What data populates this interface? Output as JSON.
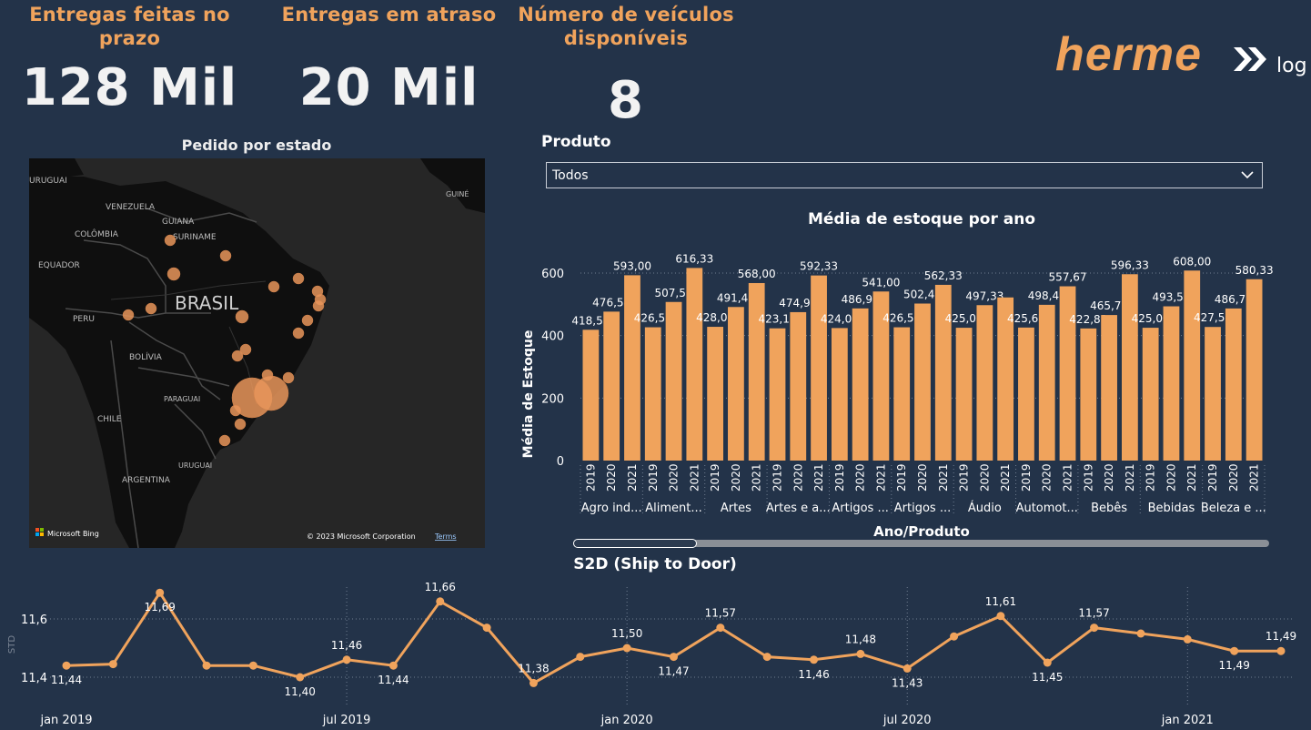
{
  "kpis": [
    {
      "title": "Entregas feitas no prazo",
      "value": "128 Mil"
    },
    {
      "title": "Entregas em atraso",
      "value": "20 Mil"
    },
    {
      "title_line1": "Número de veículos",
      "title_line2": "disponíveis",
      "value": "8"
    }
  ],
  "logo": {
    "word": "herme",
    "sub": "log",
    "icon": "double-chevron-x-icon"
  },
  "map": {
    "title": "Pedido por estado",
    "labels": [
      "GUIANA",
      "VENEZUELA",
      "COLÔMBIA",
      "SURINAME",
      "EQUADOR",
      "PERU",
      "BRASIL",
      "BOLÍVIA",
      "PARAGUAI",
      "CHILE",
      "URUGUAI",
      "ARGENTINA",
      "GUINÉ",
      "URUGUAI"
    ],
    "country_labels": [
      "URUGUAI",
      "VENEZUELA",
      "GUIANA",
      "COLÔMBIA",
      "SURINAME",
      "EQUADOR",
      "BRASIL",
      "PERU",
      "BOLÍVIA",
      "PARAGUAI",
      "CHILE",
      "ARGENTINA",
      "GUINÉ"
    ],
    "attribution": "Microsoft Bing",
    "copyright": "© 2023 Microsoft Corporation",
    "terms": "Terms",
    "bubble_color": "#e8955a"
  },
  "filter": {
    "label": "Produto",
    "value": "Todos"
  },
  "bar_chart": {
    "title": "Média de estoque por ano",
    "ylabel": "Média de Estoque",
    "xlabel": "Ano/Produto",
    "color": "#f0a35c"
  },
  "line_chart": {
    "title": "S2D (Ship to Door)",
    "ylabel": "STD",
    "color": "#f0a35c"
  },
  "chart_data": [
    {
      "type": "bar",
      "title": "Média de estoque por ano",
      "ylabel": "Média de Estoque",
      "xlabel": "Ano/Produto",
      "ylim": [
        0,
        650
      ],
      "yticks": [
        0,
        200,
        400,
        600
      ],
      "grid": true,
      "years": [
        "2019",
        "2020",
        "2021"
      ],
      "groups": [
        "Agro ind...",
        "Aliment...",
        "Artes",
        "Artes e a...",
        "Artigos ...",
        "Artigos ...",
        "Áudio",
        "Automot...",
        "Bebês",
        "Bebidas",
        "Beleza e ..."
      ],
      "values": [
        418.5,
        476.58,
        593.0,
        426.58,
        507.5,
        616.33,
        428.0,
        491.42,
        568.0,
        423.17,
        474.92,
        592.33,
        424.08,
        486.92,
        541.0,
        426.5,
        502.42,
        562.33,
        425.0,
        497.33,
        522.0,
        425.67,
        498.42,
        557.67,
        422.83,
        465.75,
        596.33,
        425.0,
        493.58,
        608.0,
        427.5,
        486.75,
        580.33
      ],
      "labels": [
        "418,50",
        "476,58",
        "593,00",
        "426,58",
        "507,50",
        "616,33",
        "428,00",
        "491,42",
        "568,00",
        "423,17",
        "474,92",
        "592,33",
        "424,08",
        "486,92",
        "541,00",
        "426,50",
        "502,42",
        "562,33",
        "425,00",
        "497,33",
        "",
        "425,67",
        "498,42",
        "557,67",
        "422,83",
        "465,75",
        "596,33",
        "425,00",
        "493,58",
        "608,00",
        "427,50",
        "486,75",
        "580,33"
      ]
    },
    {
      "type": "line",
      "title": "S2D (Ship to Door)",
      "ylabel": "STD",
      "ylim": [
        11.37,
        11.72
      ],
      "yticks": [
        11.4,
        11.6
      ],
      "ytick_labels": [
        "11,4",
        "11,6"
      ],
      "x": [
        "2019-01",
        "2019-02",
        "2019-03",
        "2019-04",
        "2019-05",
        "2019-06",
        "2019-07",
        "2019-08",
        "2019-09",
        "2019-10",
        "2019-11",
        "2019-12",
        "2020-01",
        "2020-02",
        "2020-03",
        "2020-04",
        "2020-05",
        "2020-06",
        "2020-07",
        "2020-08",
        "2020-09",
        "2020-10",
        "2020-11",
        "2020-12",
        "2021-01",
        "2021-02",
        "2021-03",
        "2021-04",
        "2021-05",
        "2021-06",
        "2021-07"
      ],
      "x_ticks": [
        "jan 2019",
        "jul 2019",
        "jan 2020",
        "jul 2020",
        "jan 2021"
      ],
      "values": [
        11.44,
        11.445,
        11.69,
        11.44,
        11.44,
        11.4,
        11.46,
        11.44,
        11.66,
        11.57,
        11.38,
        11.47,
        11.5,
        11.47,
        11.57,
        11.47,
        11.46,
        11.48,
        11.43,
        11.54,
        11.61,
        11.45,
        11.57,
        11.55,
        11.53,
        11.49,
        11.49
      ],
      "point_labels": [
        "11,44",
        "",
        "11,69",
        "",
        "",
        "11,40",
        "11,46",
        "11,44",
        "11,66",
        "",
        "11,38",
        "",
        "11,50",
        "11,47",
        "11,57",
        "",
        "11,46",
        "11,48",
        "11,43",
        "",
        "11,61",
        "11,45",
        "11,57",
        "",
        "",
        "11,49",
        "11,49"
      ],
      "label_below": [
        true,
        false,
        true,
        false,
        false,
        true,
        false,
        true,
        false,
        false,
        false,
        false,
        false,
        true,
        false,
        false,
        true,
        false,
        true,
        false,
        false,
        true,
        false,
        false,
        false,
        true,
        false
      ]
    }
  ]
}
